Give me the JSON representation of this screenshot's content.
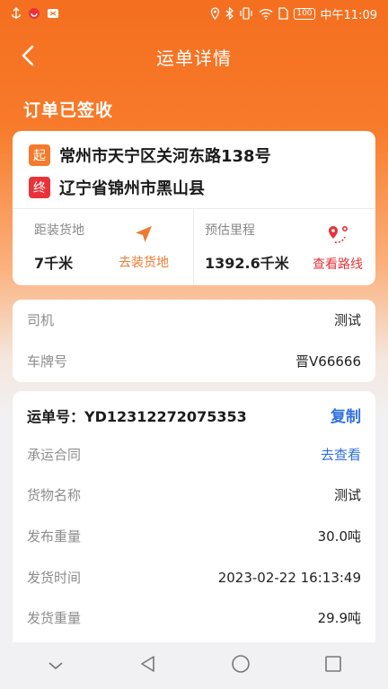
{
  "status_bar": {
    "carrier_icons": [
      "usb-icon",
      "app-notification-icon",
      "sim-icon"
    ],
    "right_icons": [
      "location-icon",
      "bluetooth-icon",
      "vibrate-icon",
      "wifi-icon",
      "sim-card-icon"
    ],
    "battery": "100",
    "time": "中午11:09"
  },
  "nav": {
    "title": "运单详情"
  },
  "order_status": "订单已签收",
  "route": {
    "start_tag": "起",
    "start_address": "常州市天宁区关河东路138号",
    "end_tag": "终",
    "end_address": "辽宁省锦州市黑山县",
    "distance_label": "距装货地",
    "distance_value": "7千米",
    "go_label": "去装货地",
    "mileage_label": "预估里程",
    "mileage_value": "1392.6千米",
    "view_route_label": "查看路线"
  },
  "driver": {
    "driver_label": "司机",
    "driver_value": "测试",
    "plate_label": "车牌号",
    "plate_value": "晋V66666"
  },
  "order": {
    "order_no": "运单号：YD12312272075353",
    "copy_label": "复制",
    "rows": [
      {
        "label": "承运合同",
        "value": "去查看"
      },
      {
        "label": "货物名称",
        "value": "测试"
      },
      {
        "label": "发布重量",
        "value": "30.0吨"
      },
      {
        "label": "发货时间",
        "value": "2023-02-22 16:13:49"
      },
      {
        "label": "发货重量",
        "value": "29.9吨"
      }
    ]
  },
  "colors": {
    "brand_orange": "#f46f1f",
    "link_blue": "#2f6fe0",
    "end_red": "#e8333a"
  },
  "system_nav": [
    "collapse-icon",
    "back-triangle-icon",
    "home-circle-icon",
    "recents-square-icon"
  ]
}
